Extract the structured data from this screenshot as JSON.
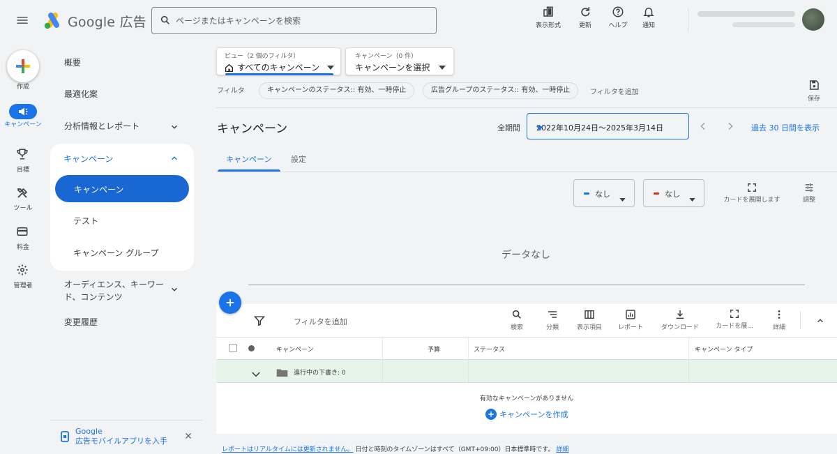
{
  "header": {
    "brand": "Google 広告",
    "search_placeholder": "ページまたはキャンペーンを検索",
    "tools": [
      {
        "label": "表示形式",
        "icon": "appearance-icon"
      },
      {
        "label": "更新",
        "icon": "refresh-icon"
      },
      {
        "label": "ヘルプ",
        "icon": "help-icon"
      },
      {
        "label": "通知",
        "icon": "bell-icon"
      }
    ]
  },
  "rail": {
    "create": "作成",
    "campaigns": "キャンペーン",
    "goals": "目標",
    "tools": "ツール",
    "billing": "料金",
    "admin": "管理者"
  },
  "nav": {
    "overview": "概要",
    "recommendations": "最適化案",
    "insights": "分析情報とレポート",
    "campaigns_group": "キャンペーン",
    "campaigns_item": "キャンペーン",
    "tests": "テスト",
    "campaign_groups": "キャンペーン グループ",
    "audiences_line1": "オーディエンス、キーワー",
    "audiences_line2": "ド、コンテンツ",
    "change_history": "変更履歴",
    "promo_line1": "Google",
    "promo_line2": "広告モバイルアプリを入手"
  },
  "filters": {
    "view_caption": "ビュー（2 個のフィルタ）",
    "view_value": "すべてのキャンペーン",
    "campaign_caption": "キャンペーン（0 件）",
    "campaign_value": "キャンペーンを選択",
    "label": "フィルタ",
    "chip1": "キャンペーンのステータス:: 有効、一時停止",
    "chip2": "広告グループのステータス:: 有効、一時停止",
    "add": "フィルタを追加",
    "save": "保存"
  },
  "page": {
    "title": "キャンペーン",
    "period_label": "全期間",
    "date_range": "2022年10月24日～2025年3月14日",
    "last30": "過去 30 日間を表示",
    "tab_campaigns": "キャンペーン",
    "tab_settings": "設定"
  },
  "chart": {
    "metric1": "なし",
    "metric2": "なし",
    "metric1_color": "#1a73e8",
    "metric2_color": "#d93025",
    "expand": "カードを展開します",
    "adjust": "調整",
    "no_data": "データなし"
  },
  "table": {
    "filter_add": "フィルタを追加",
    "tools": [
      "検索",
      "分類",
      "表示項目",
      "レポート",
      "ダウンロード",
      "カードを展...",
      "詳細"
    ],
    "columns": {
      "campaign": "キャンペーン",
      "budget": "予算",
      "status": "ステータス",
      "type": "キャンペーン タイプ"
    },
    "drafts": "進行中の下書き: 0",
    "empty": "有効なキャンペーンがありません",
    "create": "キャンペーンを作成"
  },
  "footer": {
    "link": "レポートはリアルタイムには更新されません。",
    "text": " 日付と時刻のタイムゾーンはすべて（GMT+09:00）日本標準時です。",
    "details": "詳細"
  }
}
